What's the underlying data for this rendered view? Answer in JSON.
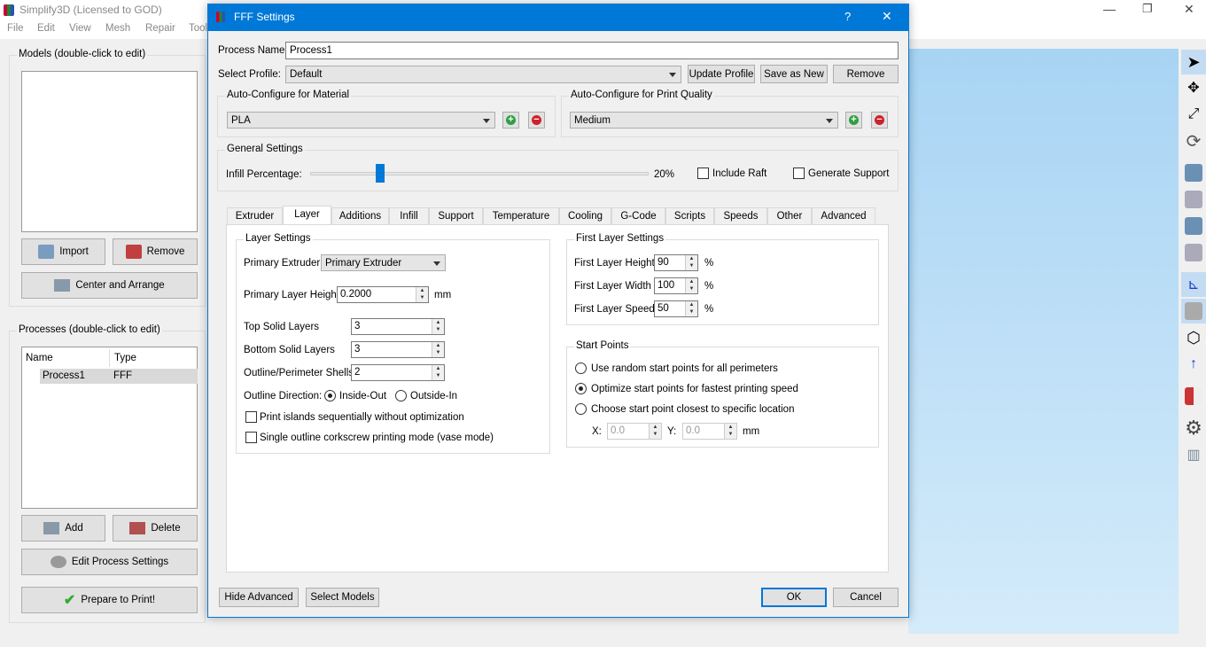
{
  "app": {
    "title": "Simplify3D (Licensed to GOD)",
    "menu": [
      "File",
      "Edit",
      "View",
      "Mesh",
      "Repair",
      "Tools"
    ],
    "models_group": "Models (double-click to edit)",
    "import": "Import",
    "remove": "Remove",
    "center_arrange": "Center and Arrange",
    "processes_group": "Processes (double-click to edit)",
    "col_name": "Name",
    "col_type": "Type",
    "processes": [
      {
        "name": "Process1",
        "type": "FFF"
      }
    ],
    "add": "Add",
    "delete": "Delete",
    "edit_process": "Edit Process Settings",
    "prepare": "Prepare to Print!"
  },
  "dialog": {
    "title": "FFF Settings",
    "help": "?",
    "close": "✕",
    "process_name_label": "Process Name:",
    "process_name": "Process1",
    "select_profile_label": "Select Profile:",
    "profile": "Default",
    "update_profile": "Update Profile",
    "save_as_new": "Save as New",
    "remove": "Remove",
    "material_group": "Auto-Configure for Material",
    "material": "PLA",
    "quality_group": "Auto-Configure for Print Quality",
    "quality": "Medium",
    "general_group": "General Settings",
    "infill_label": "Infill Percentage:",
    "infill_value": "20%",
    "infill_percent": 20,
    "include_raft": "Include Raft",
    "generate_support": "Generate Support",
    "tabs": [
      "Extruder",
      "Layer",
      "Additions",
      "Infill",
      "Support",
      "Temperature",
      "Cooling",
      "G-Code",
      "Scripts",
      "Speeds",
      "Other",
      "Advanced"
    ],
    "selected_tab": "Layer",
    "layer": {
      "group": "Layer Settings",
      "primary_extruder_label": "Primary Extruder",
      "primary_extruder": "Primary Extruder",
      "layer_height_label": "Primary Layer Height",
      "layer_height": "0.2000",
      "mm": "mm",
      "top_label": "Top Solid Layers",
      "top": "3",
      "bottom_label": "Bottom Solid Layers",
      "bottom": "3",
      "shells_label": "Outline/Perimeter Shells",
      "shells": "2",
      "direction_label": "Outline Direction:",
      "inside_out": "Inside-Out",
      "outside_in": "Outside-In",
      "islands": "Print islands sequentially without optimization",
      "vase": "Single outline corkscrew printing mode (vase mode)"
    },
    "first_layer": {
      "group": "First Layer Settings",
      "height_label": "First Layer Height",
      "height": "90",
      "width_label": "First Layer Width",
      "width": "100",
      "speed_label": "First Layer Speed",
      "speed": "50",
      "pct": "%"
    },
    "start_points": {
      "group": "Start Points",
      "random": "Use random start points for all perimeters",
      "optimize": "Optimize start points for fastest printing speed",
      "closest": "Choose start point closest to specific location",
      "x_label": "X:",
      "x": "0.0",
      "y_label": "Y:",
      "y": "0.0",
      "mm": "mm"
    },
    "hide_advanced": "Hide Advanced",
    "select_models": "Select Models",
    "ok": "OK",
    "cancel": "Cancel"
  },
  "colors": {
    "accent": "#0078d7",
    "viewport": "#b9dcf5"
  }
}
